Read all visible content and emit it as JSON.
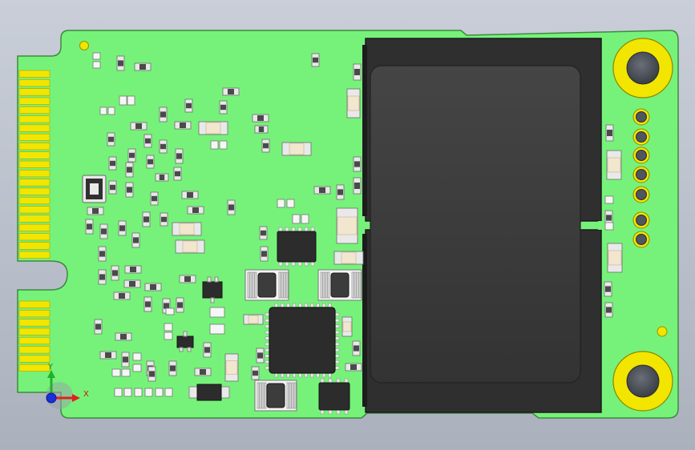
{
  "scene": {
    "background_top": "#c9ced8",
    "background_bottom": "#aab1bd",
    "board_color": "#76f27a",
    "board_edge": "#3e8a3f",
    "gold_finger_color": "#f2e600",
    "mounting_hole_ring": "#f2e600",
    "mounting_hole_center": "#4a4f57",
    "nand_package_color": "#3b3b3b",
    "nand_die_color": "#4c4c4c",
    "ic_color": "#303030",
    "passive_cap_color": "#f3e6cf",
    "passive_body_color": "#e9e9e9"
  },
  "triad": {
    "x_label": "X",
    "y_label": "Y",
    "x_color": "#e02020",
    "y_color": "#22b02a",
    "origin_color": "#1930d8"
  },
  "components": {
    "test_pad_count": 7,
    "edge_finger_count_upper": 21,
    "edge_finger_count_lower": 8
  }
}
